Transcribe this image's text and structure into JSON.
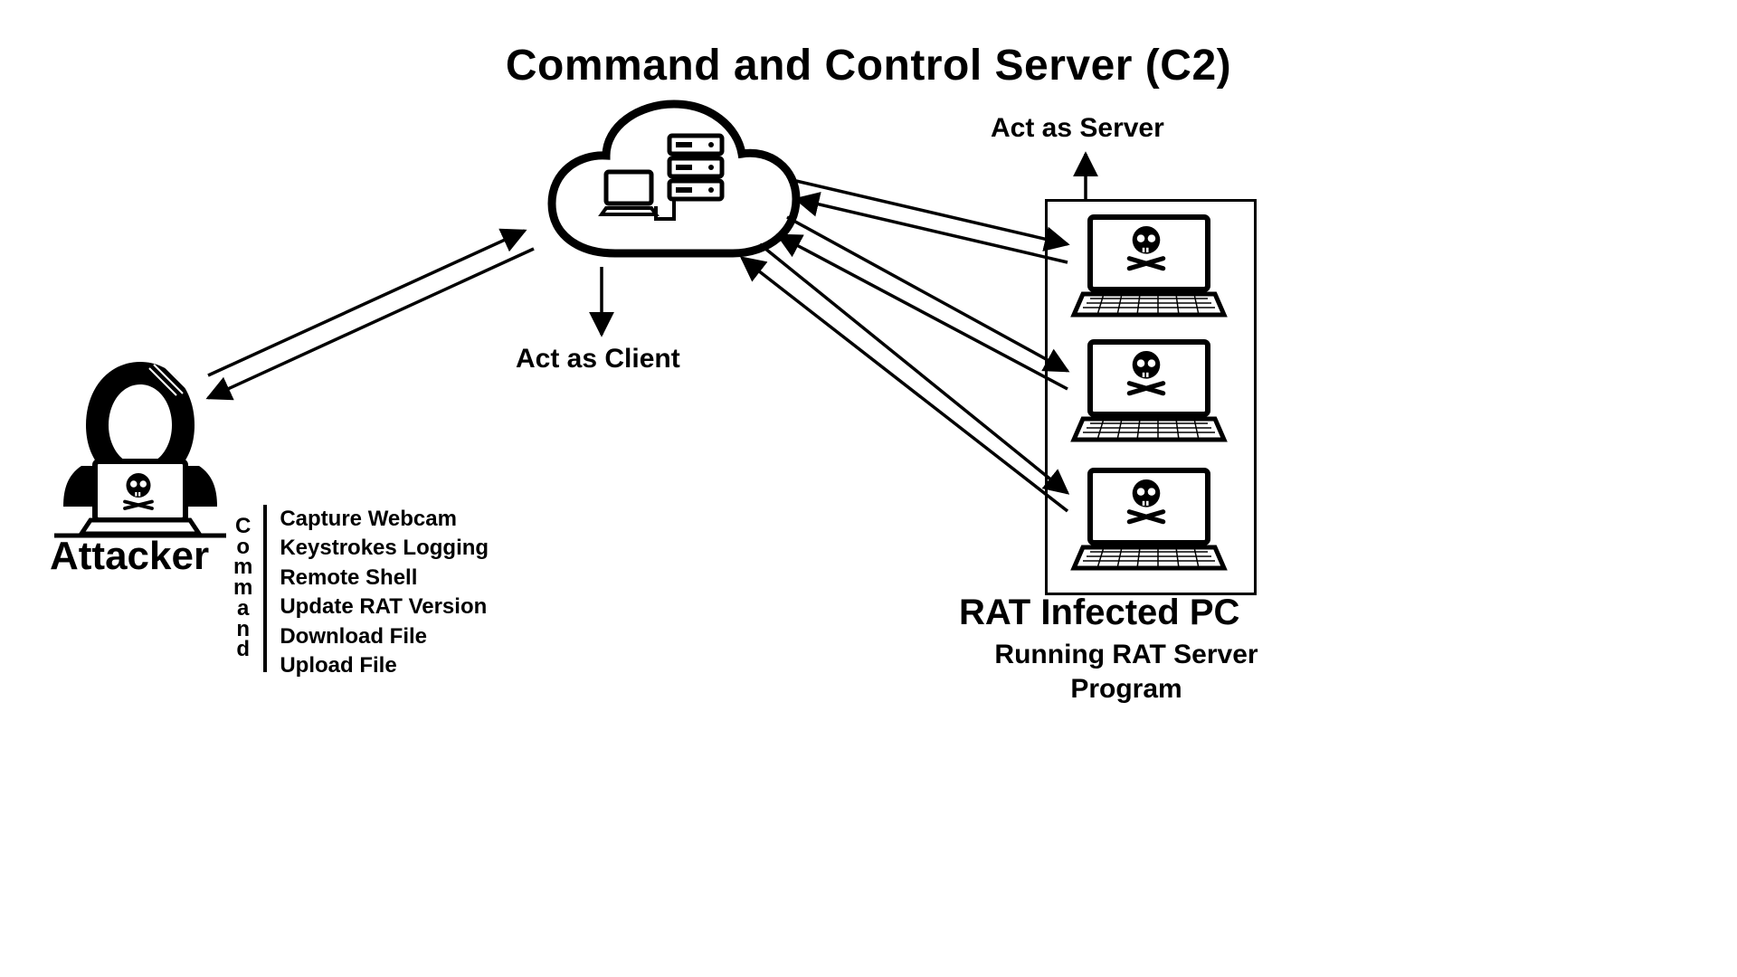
{
  "title": "Command and Control Server (C2)",
  "attacker_label": "Attacker",
  "act_as_client": "Act as Client",
  "act_as_server": "Act as Server",
  "infected_title": "RAT Infected PC",
  "infected_sub": "Running RAT Server Program",
  "command_vert_label": "Command",
  "commands": [
    "Capture Webcam",
    "Keystrokes Logging",
    "Remote Shell",
    "Update RAT Version",
    "Download File",
    "Upload File"
  ]
}
